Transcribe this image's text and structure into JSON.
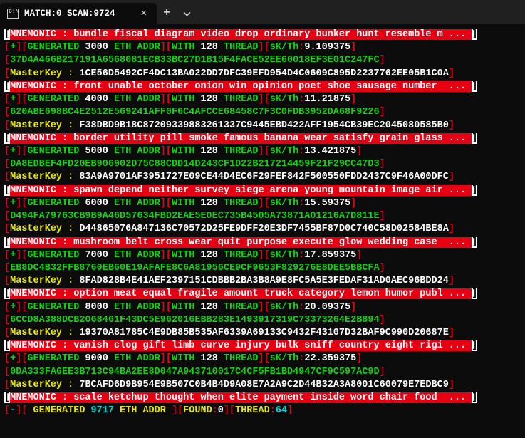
{
  "window": {
    "title": "MATCH:0 SCAN:9724"
  },
  "blocks": [
    {
      "mnemonic": "MNEMONIC : bundle fiscal diagram video drop ordinary bunker hunt resemble m ... ",
      "count": "3000",
      "threads": "128",
      "sk": "9.109375",
      "seed": "37D4A466B217191A6568081ECB33BC27D1B15F4FACE52EE60018EF3E01C247FC",
      "master": "1CE56D5492CF4DC13BA022DD7DFC39EFD954D4C0609C895D2237762EE05B1C0A"
    },
    {
      "mnemonic": "MNEMONIC : front unable october onion win opinion poet shoe sausage number  ... ",
      "count": "4000",
      "threads": "128",
      "sk": "11.21875",
      "seed": "620ABE698BC4E2512E569241AFF0F6C4AFCCE68458C7F3C0FDB3952DA68F9226",
      "master": "F38DBD9B18C87209339883261337C9445EBD422AFF1954CB39EC2045080585B0"
    },
    {
      "mnemonic": "MNEMONIC : border utility pill smoke famous banana wear satisfy grain glass ... ",
      "count": "5000",
      "threads": "128",
      "sk": "13.421875",
      "seed": "DA8EDBEF4FD20EB906902D75C88CDD14D243CF1D22B217214459F21F29CC47D3",
      "master": "83A9A9701AF3951727E09CE44D4EC6F29FEF842F500550FDD2437C9F46A00DFC"
    },
    {
      "mnemonic": "MNEMONIC : spawn depend neither survey siege arena young mountain image air ... ",
      "count": "6000",
      "threads": "128",
      "sk": "15.59375",
      "seed": "D494FA79763CB9B9A46D57634FBD2EAE5E0EC735B4505A73871A01216A7D811E",
      "master": "D44865076A847136C70572D25FE9DFF20E3DF7455BF87D0C740C58D02584BE8A"
    },
    {
      "mnemonic": "MNEMONIC : mushroom belt cross wear quit purpose execute glow wedding case  ... ",
      "count": "7000",
      "threads": "128",
      "sk": "17.859375",
      "seed": "EB8DC4B32FFB8760EB60E19AFAFE8C6A81956CE9CF9653F829276E8DEE5BBCFA",
      "master": "8FAD828B4E41AEF2397151CDBBB2BA3B8A9E8FC5A5E3FEDAF31AD0AEC96BDD24"
    },
    {
      "mnemonic": "MNEMONIC : option meat equal fragile amount truck category lemon humor publ ... ",
      "count": "8000",
      "threads": "128",
      "sk": "20.09375",
      "seed": "6CCD8A388DCB2068461F43DC5E962016EBB283E1493917319C73373264E2B894",
      "master": "19370A81785C4E9DB85B535AF6339A69133C9432F43107D32BAF9C990D20687E"
    },
    {
      "mnemonic": "MNEMONIC : vanish clog gift limb curve injury bulk sniff country eight rigi ... ",
      "count": "9000",
      "threads": "128",
      "sk": "22.359375",
      "seed": "0DA333FA6EE3B713C94BA2EE8D047A943710017C4CF5FB1BD4947CF9C597AC9D",
      "master": "7BCAFD6D9B954E9B507C0B4B4D9A08E7A2A9C2D44B32A3A8001C60079E7EDBC9"
    }
  ],
  "last": {
    "mnemonic": "MNEMONIC : scale ketchup thought when elite payment inside word chair food  ... ",
    "gen_count": "9717",
    "found": "0",
    "threads": "64"
  },
  "labels": {
    "generated": "GENERATED",
    "eth_addr": "ETH ADDR",
    "eth_addr_sp": " ETH ADDR ",
    "with": "WITH",
    "thread": "THREAD",
    "skth": "sK/Th",
    "master": "MasterKey :",
    "found": "FOUND",
    "generated_sp": " GENERATED "
  }
}
